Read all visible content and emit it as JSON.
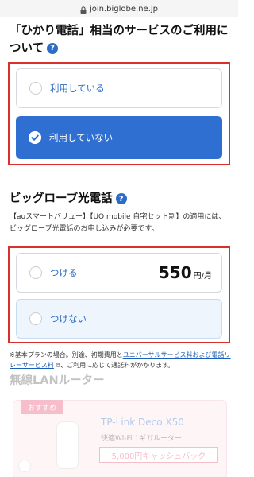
{
  "browser": {
    "url": "join.biglobe.ne.jp"
  },
  "section1": {
    "title": "「ひかり電話」相当のサービスのご利用について",
    "options": [
      {
        "label": "利用している",
        "selected": false
      },
      {
        "label": "利用していない",
        "selected": true
      }
    ]
  },
  "section2": {
    "title": "ビッグローブ光電話",
    "description": "【auスマートバリュー】【UQ mobile 自宅セット割】の適用には、ビッグローブ光電話のお申し込みが必要です。",
    "options": [
      {
        "label": "つける",
        "price": "550",
        "unit": "円/月",
        "selected": false
      },
      {
        "label": "つけない",
        "selected": false
      }
    ],
    "note_prefix": "※基本プランの場合。別途、初期費用と",
    "note_link": "ユニバーサルサービス料および電話リレーサービス料",
    "note_suffix": "、ご利用に応じて通話料がかかります。"
  },
  "section3": {
    "title": "無線LANルーター",
    "badge": "おすすめ",
    "product_name": "TP-Link Deco X50",
    "product_sub": "快適Wi-Fi 1ギガルーター",
    "cashback": "5,000円キャッシュバック"
  },
  "colors": {
    "accent": "#2b6cc4",
    "selected_bg": "#2f6fd1",
    "highlight": "#d9302c",
    "light_bg": "#eef5fd"
  }
}
